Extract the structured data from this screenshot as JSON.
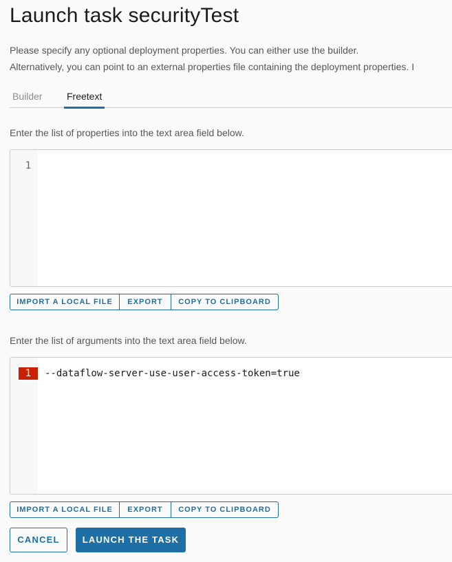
{
  "page": {
    "title": "Launch task securityTest",
    "description_line1": "Please specify any optional deployment properties. You can either use the builder.",
    "description_line2": "Alternatively, you can point to an external properties file containing the deployment properties. I"
  },
  "tabs": [
    {
      "label": "Builder",
      "active": false
    },
    {
      "label": "Freetext",
      "active": true
    }
  ],
  "properties_section": {
    "label": "Enter the list of properties into the text area field below.",
    "editor": {
      "lines": [
        {
          "number": "1",
          "text": "",
          "error": false
        }
      ]
    },
    "buttons": {
      "import": "IMPORT A LOCAL FILE",
      "export": "EXPORT",
      "copy": "COPY TO CLIPBOARD"
    }
  },
  "arguments_section": {
    "label": "Enter the list of arguments into the text area field below.",
    "editor": {
      "lines": [
        {
          "number": "1",
          "text": "--dataflow-server-use-user-access-token=true",
          "error": true
        }
      ]
    },
    "buttons": {
      "import": "IMPORT A LOCAL FILE",
      "export": "EXPORT",
      "copy": "COPY TO CLIPBOARD"
    }
  },
  "actions": {
    "cancel": "CANCEL",
    "launch": "LAUNCH THE TASK"
  },
  "colors": {
    "accent": "#1d6fa5",
    "error": "#c92100",
    "background": "#fafafa"
  }
}
